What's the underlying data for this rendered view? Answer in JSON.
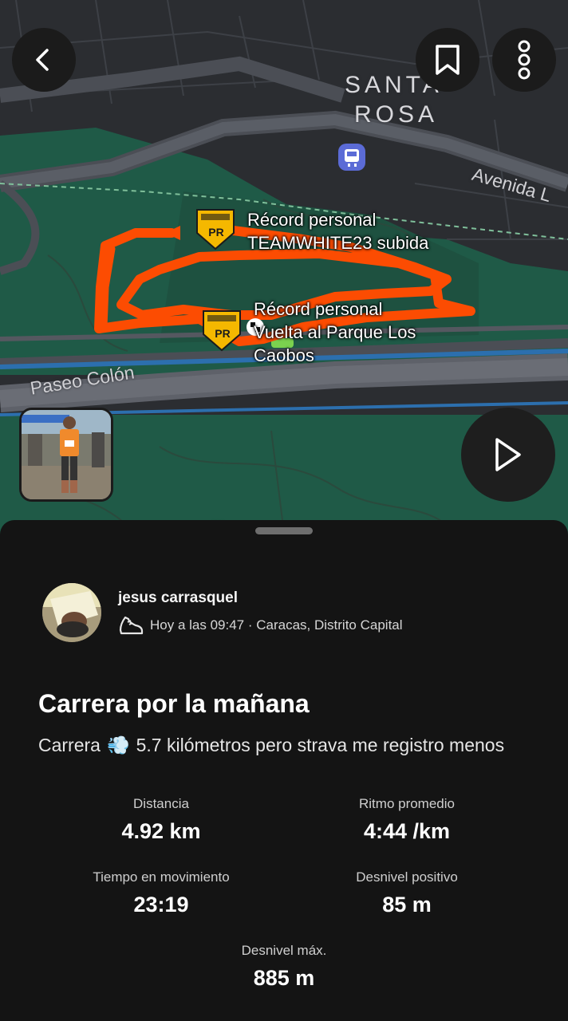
{
  "header": {
    "back_icon": "chevron-left-icon",
    "bookmark_icon": "bookmark-icon",
    "more_icon": "more-vertical-icon"
  },
  "map": {
    "area_label_line1": "SANTA",
    "area_label_line2": "ROSA",
    "street_avenida": "Avenida L",
    "street_paseo": "Paseo Colón",
    "partial_label": "...",
    "route_color": "#fc4c02",
    "pr_badge_text": "PR",
    "pr_label_1_line1": "Récord personal",
    "pr_label_1_line2": "TEAMWHITE23 subida",
    "pr_label_2_line1": "Récord personal",
    "pr_label_2_line2": "Vuelta al Parque Los",
    "pr_label_2_line3": "Caobos",
    "play_icon": "play-icon"
  },
  "activity": {
    "athlete_name": "jesus carrasquel",
    "activity_icon": "running-shoe-icon",
    "meta": "Hoy a las 09:47 · Caracas, Distrito Capital",
    "title": "Carrera por la mañana",
    "description_prefix": "Carrera",
    "description_emoji": "💨",
    "description_suffix": "5.7 kilómetros pero strava me registro menos"
  },
  "stats": [
    {
      "label": "Distancia",
      "value": "4.92 km"
    },
    {
      "label": "Ritmo promedio",
      "value": "4:44 /km"
    },
    {
      "label": "Tiempo en movimiento",
      "value": "23:19"
    },
    {
      "label": "Desnivel positivo",
      "value": "85 m"
    },
    {
      "label": "Desnivel máx.",
      "value": "885 m"
    }
  ]
}
